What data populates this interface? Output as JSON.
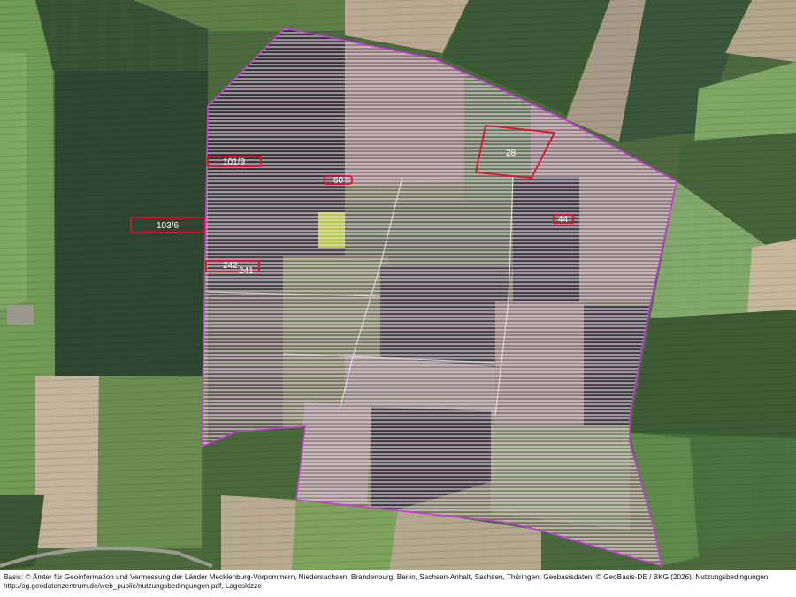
{
  "map": {
    "parcels": [
      {
        "id": "p-101-9",
        "label": "101/9"
      },
      {
        "id": "p-60",
        "label": "60"
      },
      {
        "id": "p-28",
        "label": "28"
      },
      {
        "id": "p-103-6",
        "label": "103/6"
      },
      {
        "id": "p-44",
        "label": "44"
      },
      {
        "id": "p-242",
        "label": "242"
      },
      {
        "id": "p-241",
        "label": "241"
      }
    ],
    "colors": {
      "boundary": "#c43cd6",
      "hatch": "#f4dcef",
      "parcel_outline": "#e0102a"
    }
  },
  "footer": {
    "attribution": "Basis: © Ämter für Geoinformation und Vermessung der Länder Mecklenburg-Vorpommern, Niedersachsen, Brandenburg, Berlin, Sachsen-Anhalt, Sachsen, Thüringen; Geobasisdaten: © GeoBasis-DE / BKG (2026), Nutzungsbedingungen: http://sg.geodatenzentrum.de/web_public/nutzungsbedingungen.pdf, Lageskizze"
  }
}
